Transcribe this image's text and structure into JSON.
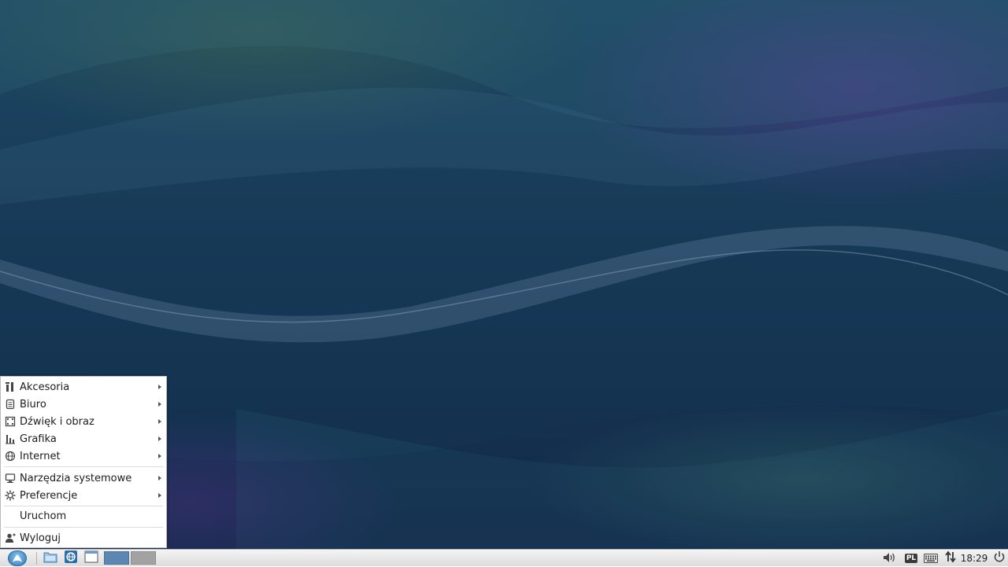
{
  "menu": {
    "items": [
      {
        "label": "Akcesoria",
        "icon": "accessories-icon",
        "submenu": true
      },
      {
        "label": "Biuro",
        "icon": "office-icon",
        "submenu": true
      },
      {
        "label": "Dźwięk i obraz",
        "icon": "multimedia-icon",
        "submenu": true
      },
      {
        "label": "Grafika",
        "icon": "graphics-icon",
        "submenu": true
      },
      {
        "label": "Internet",
        "icon": "internet-globe-icon",
        "submenu": true
      },
      {
        "label": "Narzędzia systemowe",
        "icon": "system-tools-icon",
        "submenu": true
      },
      {
        "label": "Preferencje",
        "icon": "preferences-gear-icon",
        "submenu": true
      },
      {
        "label": "Uruchom",
        "icon": "",
        "submenu": false
      },
      {
        "label": "Wyloguj",
        "icon": "logout-user-icon",
        "submenu": false
      }
    ]
  },
  "taskbar": {
    "clock": "18:29",
    "keyboard_layout": "PL",
    "launchers": [
      "file-manager-icon",
      "network-browser-icon",
      "window-icon"
    ],
    "desktops": [
      "desktop-1",
      "desktop-2"
    ],
    "active_desktop": 1
  },
  "colors": {
    "wallpaper": "#163956",
    "menu_bg": "#ffffff",
    "taskbar_bg": "#e6e6e6",
    "desktop_active": "#5b87b0",
    "desktop_inactive": "#a2a2a2"
  }
}
